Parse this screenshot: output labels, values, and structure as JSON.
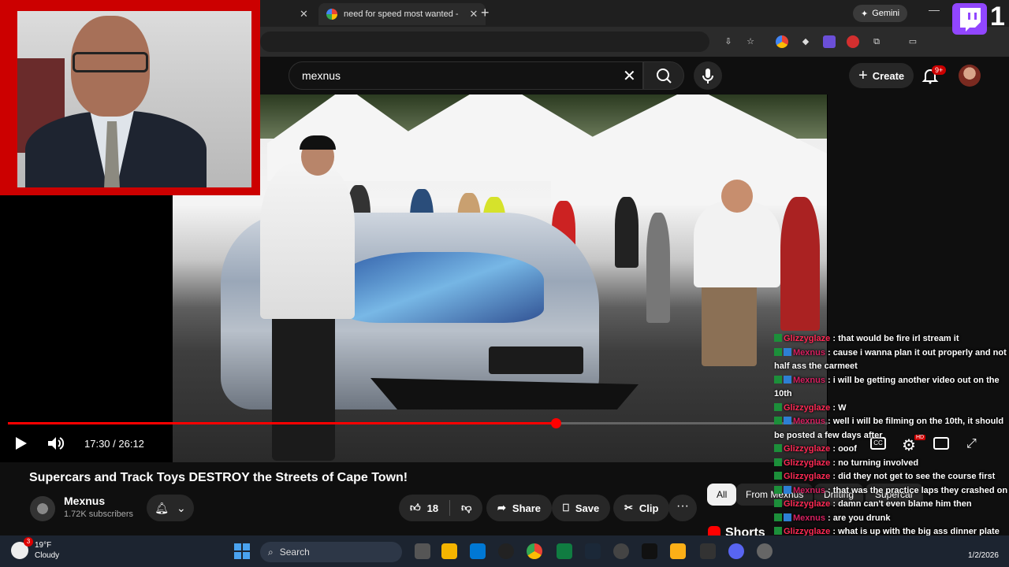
{
  "browser": {
    "tabs": [
      {
        "label": ""
      },
      {
        "label": "need for speed most wanted - "
      }
    ],
    "new_tab": "+",
    "gemini_label": "Gemini",
    "twitch_viewer_count": "1"
  },
  "youtube": {
    "search": {
      "value": "mexnus"
    },
    "create_label": "Create",
    "notif_badge": "9+"
  },
  "player": {
    "time": "17:30 / 26:12",
    "progress_fraction": 0.668,
    "cc_label": "CC",
    "hd_badge": "HD"
  },
  "video": {
    "title": "Supercars and Track Toys DESTROY the Streets of Cape Town!",
    "channel_name": "Mexnus",
    "subscribers": "1.72K subscribers",
    "like_count": "18",
    "share_label": "Share",
    "save_label": "Save",
    "clip_label": "Clip"
  },
  "chips": [
    "All",
    "From Mexnus",
    "Drifting",
    "Supercar"
  ],
  "shorts_label": "Shorts",
  "chat": [
    {
      "user": "Glizzyglaze",
      "msg": " : that would be fire irl stream it"
    },
    {
      "user": "Mexnus",
      "msg": " : cause i wanna plan it out properly and not half ass the carmeet"
    },
    {
      "user": "Mexnus",
      "msg": " : i will be getting another video out on the 10th"
    },
    {
      "user": "Glizzyglaze",
      "msg": " : W"
    },
    {
      "user": "Mexnus",
      "msg": " : well i will be filming on the 10th, it should be posted a few days after"
    },
    {
      "user": "Glizzyglaze",
      "msg": " : ooof"
    },
    {
      "user": "Glizzyglaze",
      "msg": " : no turning involved"
    },
    {
      "user": "Glizzyglaze",
      "msg": " : did they not get to see the course first"
    },
    {
      "user": "Mexnus",
      "msg": " : that was the practice laps they crashed on"
    },
    {
      "user": "Glizzyglaze",
      "msg": " : damn can't even blame him then"
    },
    {
      "user": "Mexnus",
      "msg": " : are you drunk"
    },
    {
      "user": "Glizzyglaze",
      "msg": " : what is up with the big ass dinner plate on the front"
    }
  ],
  "taskbar": {
    "weather_temp": "19°F",
    "weather_desc": "Cloudy",
    "weather_badge": "3",
    "search_placeholder": "Search",
    "date": "1/2/2026"
  }
}
